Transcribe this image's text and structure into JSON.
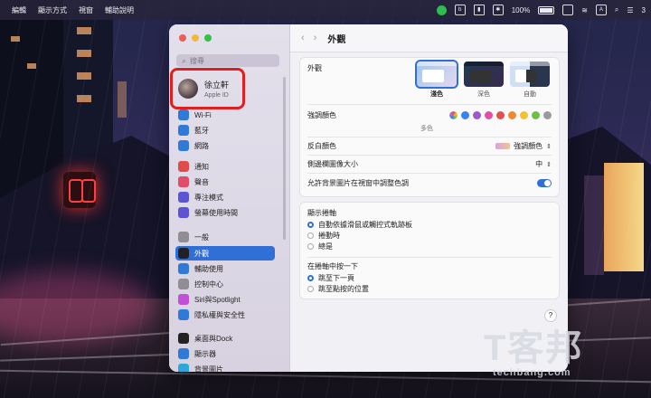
{
  "menubar": {
    "items": [
      "編輯",
      "顯示方式",
      "視窗",
      "輔助說明"
    ],
    "battery": "100%",
    "clock": "3"
  },
  "window": {
    "search_placeholder": "搜尋",
    "profile": {
      "name": "徐立軒",
      "sub": "Apple ID"
    },
    "sidebar": [
      {
        "label": "Wi-Fi",
        "icon": "wifi-icon",
        "color": "#2f7ad9"
      },
      {
        "label": "藍牙",
        "icon": "bluetooth-icon",
        "color": "#2f7ad9"
      },
      {
        "label": "網路",
        "icon": "globe-icon",
        "color": "#2f7ad9"
      },
      {
        "label": "通知",
        "icon": "bell-icon",
        "color": "#e24b4b"
      },
      {
        "label": "聲音",
        "icon": "speaker-icon",
        "color": "#e24b6a"
      },
      {
        "label": "專注模式",
        "icon": "moon-icon",
        "color": "#5b54d6"
      },
      {
        "label": "螢幕使用時間",
        "icon": "hourglass-icon",
        "color": "#5b54d6"
      },
      {
        "label": "一般",
        "icon": "gear-icon",
        "color": "#8e8e93"
      },
      {
        "label": "外觀",
        "icon": "appearance-icon",
        "color": "#222"
      },
      {
        "label": "輔助使用",
        "icon": "accessibility-icon",
        "color": "#2f7ad9"
      },
      {
        "label": "控制中心",
        "icon": "control-center-icon",
        "color": "#8e8e93"
      },
      {
        "label": "Siri與Spotlight",
        "icon": "siri-icon",
        "color": "#c24fd6"
      },
      {
        "label": "隱私權與安全性",
        "icon": "hand-icon",
        "color": "#2f7ad9"
      },
      {
        "label": "桌面與Dock",
        "icon": "dock-icon",
        "color": "#222"
      },
      {
        "label": "顯示器",
        "icon": "display-icon",
        "color": "#2f7ad9"
      },
      {
        "label": "背景圖片",
        "icon": "wallpaper-icon",
        "color": "#2fa8d9"
      }
    ],
    "active_index": 8,
    "title": "外觀",
    "appearance": {
      "label": "外觀",
      "options": [
        "淺色",
        "深色",
        "自動"
      ],
      "selected": 0
    },
    "accent": {
      "label": "強調顏色",
      "colors": [
        "#c266d9",
        "#3a82f7",
        "#9b59d0",
        "#e052a1",
        "#e2504c",
        "#ef8a33",
        "#f4c22f",
        "#6cc04a",
        "#9a9a9e"
      ],
      "caption": "多色"
    },
    "highlight": {
      "label": "反白顏色",
      "value": "強調顏色"
    },
    "sidebar_icon": {
      "label": "側邊欄圖像大小",
      "value": "中"
    },
    "wallpaper_tint": {
      "label": "允許背景圖片在視窗中調整色調",
      "on": true
    },
    "scrollbars": {
      "label": "顯示捲軸",
      "options": [
        "自動依據滑鼠或觸控式軌跡板",
        "捲動時",
        "總是"
      ],
      "selected": 0
    },
    "click_scroll": {
      "label": "在捲軸中按一下",
      "options": [
        "跳至下一頁",
        "跳至點按的位置"
      ],
      "selected": 0
    },
    "help": "?"
  },
  "watermark": {
    "big": "T客邦",
    "small": "techbang.com"
  }
}
